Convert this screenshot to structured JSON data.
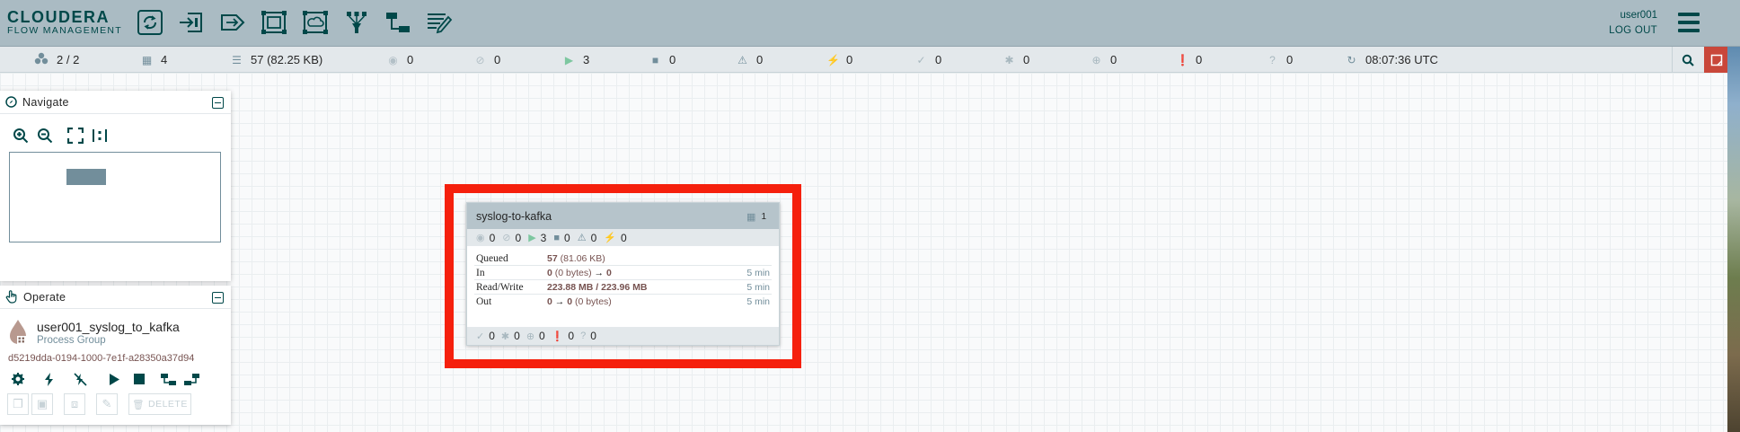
{
  "app": {
    "brand_top": "CLOUDERA",
    "brand_bottom": "FLOW MANAGEMENT"
  },
  "toolbar": {
    "items": [
      {
        "name": "processor-icon"
      },
      {
        "name": "input-port-icon"
      },
      {
        "name": "output-port-icon"
      },
      {
        "name": "process-group-icon"
      },
      {
        "name": "remote-process-group-icon"
      },
      {
        "name": "funnel-icon"
      },
      {
        "name": "template-icon"
      },
      {
        "name": "label-icon"
      }
    ]
  },
  "user": {
    "name": "user001",
    "logout": "LOG OUT"
  },
  "status": {
    "cluster": "2 / 2",
    "transmitting": "4",
    "queued": "57 (82.25 KB)",
    "disabled_remote": "0",
    "not_transmitting": "0",
    "running": "3",
    "stopped": "0",
    "invalid": "0",
    "disabled": "0",
    "up_to_date": "0",
    "locally_modified": "0",
    "stale": "0",
    "locally_modified_stale": "0",
    "sync_failure": "0",
    "last_refresh": "08:07:36 UTC"
  },
  "navigate": {
    "title": "Navigate"
  },
  "operate": {
    "title": "Operate",
    "name": "user001_syslog_to_kafka",
    "type": "Process Group",
    "id": "d5219dda-0194-1000-7e1f-a28350a37d94",
    "delete_label": "DELETE"
  },
  "process_group": {
    "name": "syslog-to-kafka",
    "ports": "1",
    "stats": {
      "transmitting": "0",
      "not_transmitting": "0",
      "running": "3",
      "stopped": "0",
      "invalid": "0",
      "disabled": "0"
    },
    "rows": {
      "queued": {
        "label": "Queued",
        "count": "57",
        "size": " (81.06 KB)"
      },
      "in": {
        "label": "In",
        "count": "0",
        "size": " (0 bytes)",
        "arrow": " → ",
        "dest": "0",
        "time": "5 min"
      },
      "readwrite": {
        "label": "Read/Write",
        "value": "223.88 MB / 223.96 MB",
        "time": "5 min"
      },
      "out": {
        "label": "Out",
        "count": "0",
        "arrow": " → ",
        "dest": "0",
        "size": " (0 bytes)",
        "time": "5 min"
      }
    },
    "versions": {
      "up_to_date": "0",
      "locally_modified": "0",
      "stale": "0",
      "locally_modified_stale": "0",
      "sync_failure": "0"
    }
  }
}
